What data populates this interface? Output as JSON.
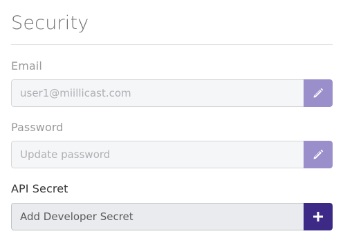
{
  "section": {
    "title": "Security"
  },
  "email": {
    "label": "Email",
    "value": "user1@miillicast.com",
    "button_icon": "pencil-icon"
  },
  "password": {
    "label": "Password",
    "placeholder": "Update password",
    "button_icon": "pencil-icon"
  },
  "api_secret": {
    "label": "API Secret",
    "placeholder": "Add Developer Secret",
    "button_icon": "plus-icon"
  },
  "colors": {
    "edit_button": "#9a8ecb",
    "add_button": "#3d2a86",
    "title": "#707070"
  }
}
